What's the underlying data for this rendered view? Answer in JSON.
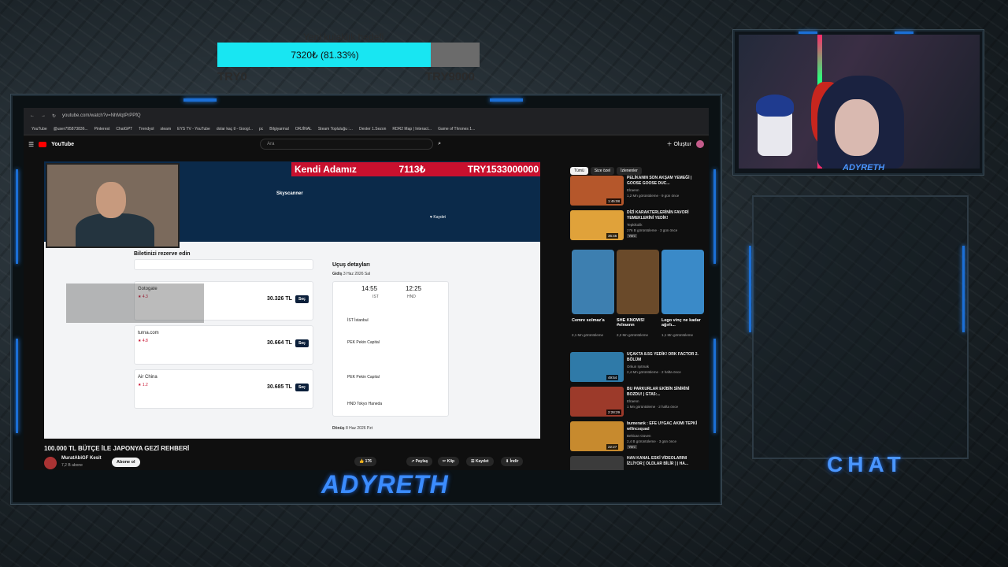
{
  "goal": {
    "label": "Yeni kulaklık hedefi",
    "text": "7320₺ (81.33%)",
    "percent": 81.33,
    "min": "TRY0",
    "max": "TRY9000"
  },
  "browser": {
    "url": "youtube.com/watch?v=NhMqtPrPPfQ",
    "bookmarks": [
      "YouTube",
      "@user795873836...",
      "Pinterest",
      "ChatGPT",
      "Trendyol",
      "steam",
      "EYS TV - YouTube",
      "dolar kaç tl - Googl...",
      "pc",
      "Bilgiyarmal",
      "ORJİNAL",
      "Steam Topluluğu :...",
      "Dexter 1.Sezon",
      "RDR2 Map | Interact...",
      "Game of Thrones 1..."
    ],
    "yt_logo": "YouTube",
    "search_placeholder": "Ara",
    "create_label": "Oluştur"
  },
  "video": {
    "title": "100.000 TL BÜTÇE İLE JAPONYA GEZİ REHBERİ",
    "channel": "MuratAbiGF Kesit",
    "subscribers": "7,2 B abone",
    "subscribe_label": "Abone ol",
    "likes": "176",
    "share_label": "Paylaş",
    "clip_label": "Klip",
    "save_label": "Kaydet",
    "download_label": "İndir",
    "overlay_name": "Kendi Adamız",
    "overlay_amount": "7113₺",
    "overlay_total": "TRY1533000000",
    "site_name": "Skyscanner",
    "save_site": "Kaydet",
    "booking_title": "Biletinizi rezerve edin",
    "flight_title": "Uçuş detayları",
    "depart_label": "Gidiş",
    "depart_date": "3 Haz 2026 Sal",
    "return_label": "Dönüş",
    "return_date": "8 Haz 2026 Pzt",
    "time_dep": "14:55",
    "time_arr": "12:25",
    "dep_code": "IST",
    "arr_code": "HND",
    "offers": [
      {
        "name": "Gotogate",
        "rating": "4.3",
        "price": "30.326 TL"
      },
      {
        "name": "turna.com",
        "rating": "4.8",
        "price": "30.664 TL"
      },
      {
        "name": "Air China",
        "rating": "1.2",
        "price": "30.685 TL"
      }
    ],
    "select_label": "Seç",
    "stops": [
      "İST İstanbul",
      "PEK Pekin Capital",
      "PEK Pekin Capital",
      "HND Tokyo Haneda"
    ]
  },
  "sidebar": {
    "chips": [
      "Tümü",
      "Size özel",
      "İzlenenler"
    ],
    "recs": [
      {
        "title": "PELİKANIN SON AKŞAM YEMEĞİ | GOOSE GOOSE DUC...",
        "channel": "Elraenn",
        "meta": "1,2 Mn görüntüleme · 9 gün önce",
        "dur": "1:45:08"
      },
      {
        "title": "DİZİ KARAKTERLERİNİN FAVORİ YEMEKLERİNİ YEDİK!",
        "channel": "Tepkikolik",
        "meta": "276 B görüntüleme · 3 gün önce",
        "dur": "36:46",
        "badge": "Yeni"
      }
    ],
    "shorts": [
      {
        "title": "Cemre solmaz'a",
        "meta": "2,1 Mn görüntüleme"
      },
      {
        "title": "SHE KNOWS! #elraenn",
        "meta": "2,2 Mn görüntüleme"
      },
      {
        "title": "Lego vinç ne kadar ağırlı...",
        "meta": "1,1 Mn görüntüleme"
      }
    ],
    "recs2": [
      {
        "title": "UÇAKTA 8.5G YEDİK! ORK FACTOR 2. BÖLÜM",
        "channel": "Orkun Işıtmak",
        "meta": "2,4 Mn görüntüleme · 2 hafta önce",
        "dur": "49:54"
      },
      {
        "title": "BU PARKURLAR EKİBİN SİNİRİNİ BOZDU! | GTA5:...",
        "channel": "Elraenn",
        "meta": "1 Mn görüntüleme · 2 hafta önce",
        "dur": "2:28:29"
      },
      {
        "title": "bumerank : EFE UYGAC AKIMI TEPKİ w/lincsquad",
        "channel": "Beltican Güven",
        "meta": "2,4 B görüntüleme · 3 gün önce",
        "dur": "22:27",
        "badge": "Yeni"
      },
      {
        "title": "HAN KANAL ESKİ VİDEOLARINI İZLİYOR [ OLDLAR BİLİR ] | HA...",
        "channel": "",
        "meta": "",
        "dur": ""
      }
    ]
  },
  "brand": "ADYRETH",
  "cam_name": "ADYRETH",
  "chat_title": "CHAT",
  "colors": {
    "accent": "#3b8cff",
    "goal": "#18e6f2",
    "overlay_red": "#c8102e"
  }
}
